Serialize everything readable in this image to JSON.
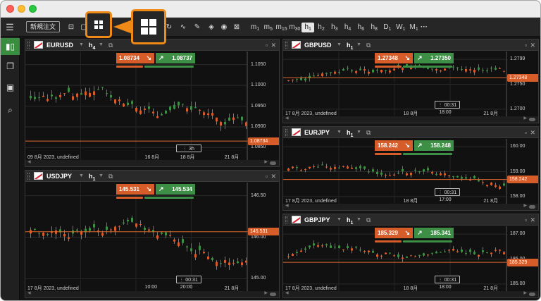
{
  "toolbar": {
    "new_order": "新規注文",
    "timeframes": [
      {
        "main": "m",
        "sub": "1"
      },
      {
        "main": "m",
        "sub": "5"
      },
      {
        "main": "m",
        "sub": "15"
      },
      {
        "main": "m",
        "sub": "30"
      },
      {
        "main": "h",
        "sub": "1"
      },
      {
        "main": "h",
        "sub": "2"
      },
      {
        "main": "h",
        "sub": "3"
      },
      {
        "main": "h",
        "sub": "4"
      },
      {
        "main": "h",
        "sub": "6"
      },
      {
        "main": "h",
        "sub": "8"
      },
      {
        "main": "D",
        "sub": "1"
      },
      {
        "main": "W",
        "sub": "1"
      },
      {
        "main": "M",
        "sub": "1"
      }
    ],
    "more": "···"
  },
  "colors": {
    "accent": "#f08a17",
    "sell": "#d65c2a",
    "buy": "#3c8f45",
    "price_line": "#e06a2c"
  },
  "panels": [
    {
      "symbol": "EURUSD",
      "tf_main": "h",
      "tf_sub": "4",
      "sell": "1.08734",
      "buy": "1.08737",
      "yticks": [
        "1.1050",
        "1.1000",
        "1.0950",
        "1.0900",
        "1.0850"
      ],
      "price_tag": "1.08734",
      "xlabels": [
        "09 8月 2023, undefined",
        "16 8月",
        "18 8月",
        "21 8月"
      ],
      "crosshair": "3h"
    },
    {
      "symbol": "GBPUSD",
      "tf_main": "h",
      "tf_sub": "1",
      "sell": "1.27348",
      "buy": "1.27350",
      "yticks": [
        "1.2799",
        "1.2750",
        "1.2700"
      ],
      "price_tag": "1.27348",
      "xlabels": [
        "17 8月 2023, undefined",
        "18 8月",
        "18:00",
        "21 8月"
      ],
      "crosshair": "00:31"
    },
    {
      "symbol": "EURJPY",
      "tf_main": "h",
      "tf_sub": "1",
      "sell": "158.242",
      "buy": "158.248",
      "yticks": [
        "160.00",
        "159.00",
        "158.00"
      ],
      "price_tag": "158.242",
      "xlabels": [
        "17 8月 2023, undefined",
        "18 8月",
        "17:00",
        "21 8月"
      ],
      "crosshair": "00:31"
    },
    {
      "symbol": "USDJPY",
      "tf_main": "h",
      "tf_sub": "1",
      "sell": "145.531",
      "buy": "145.534",
      "yticks": [
        "146.50",
        "146.00",
        "145.00"
      ],
      "price_tag": "145.531",
      "xlabels": [
        "17 8月 2023, undefined",
        "10:00",
        "20:00",
        "21 8月"
      ],
      "crosshair": "00:31"
    },
    {
      "symbol": "GBPJPY",
      "tf_main": "h",
      "tf_sub": "1",
      "sell": "185.329",
      "buy": "185.341",
      "yticks": [
        "187.00",
        "186.00",
        "185.00"
      ],
      "price_tag": "185.329",
      "xlabels": [
        "17 8月 2023, undefined",
        "18 8月",
        "18:00",
        "21 8月"
      ],
      "crosshair": "00:31"
    }
  ]
}
